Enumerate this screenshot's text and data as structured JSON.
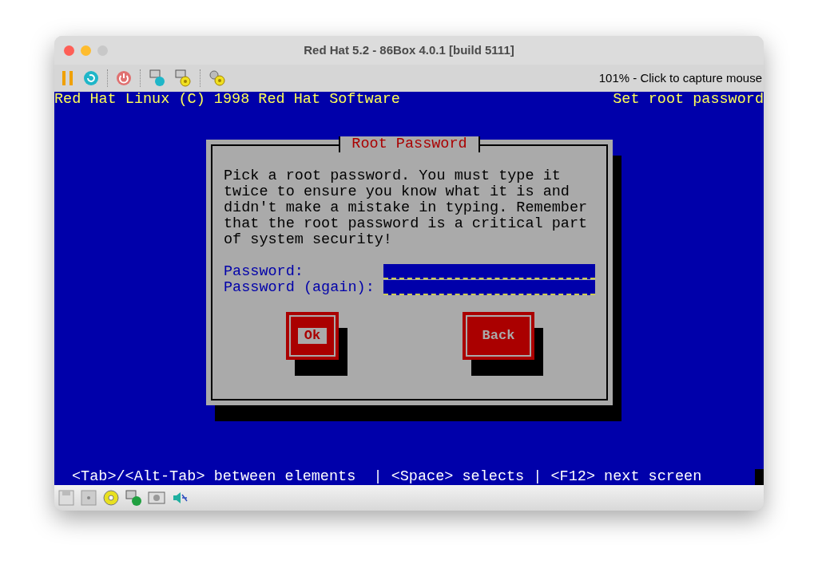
{
  "window": {
    "title": "Red Hat 5.2 - 86Box 4.0.1 [build 5111]"
  },
  "toolbar": {
    "status": "101% - Click to capture mouse"
  },
  "screen": {
    "header_left": "Red Hat Linux (C) 1998 Red Hat Software",
    "header_right": "Set root password",
    "dialog": {
      "title": "Root Password",
      "message": "Pick a root password. You must type it\ntwice to ensure you know what it is and\ndidn't make a mistake in typing. Remember\nthat the root password is a critical part\nof system security!",
      "fields": [
        {
          "label": "Password:"
        },
        {
          "label": "Password (again):"
        }
      ],
      "buttons": [
        {
          "label": "Ok",
          "selected": true
        },
        {
          "label": "Back",
          "selected": false
        }
      ]
    },
    "help_line": "<Tab>/<Alt-Tab> between elements  | <Space> selects | <F12> next screen"
  }
}
